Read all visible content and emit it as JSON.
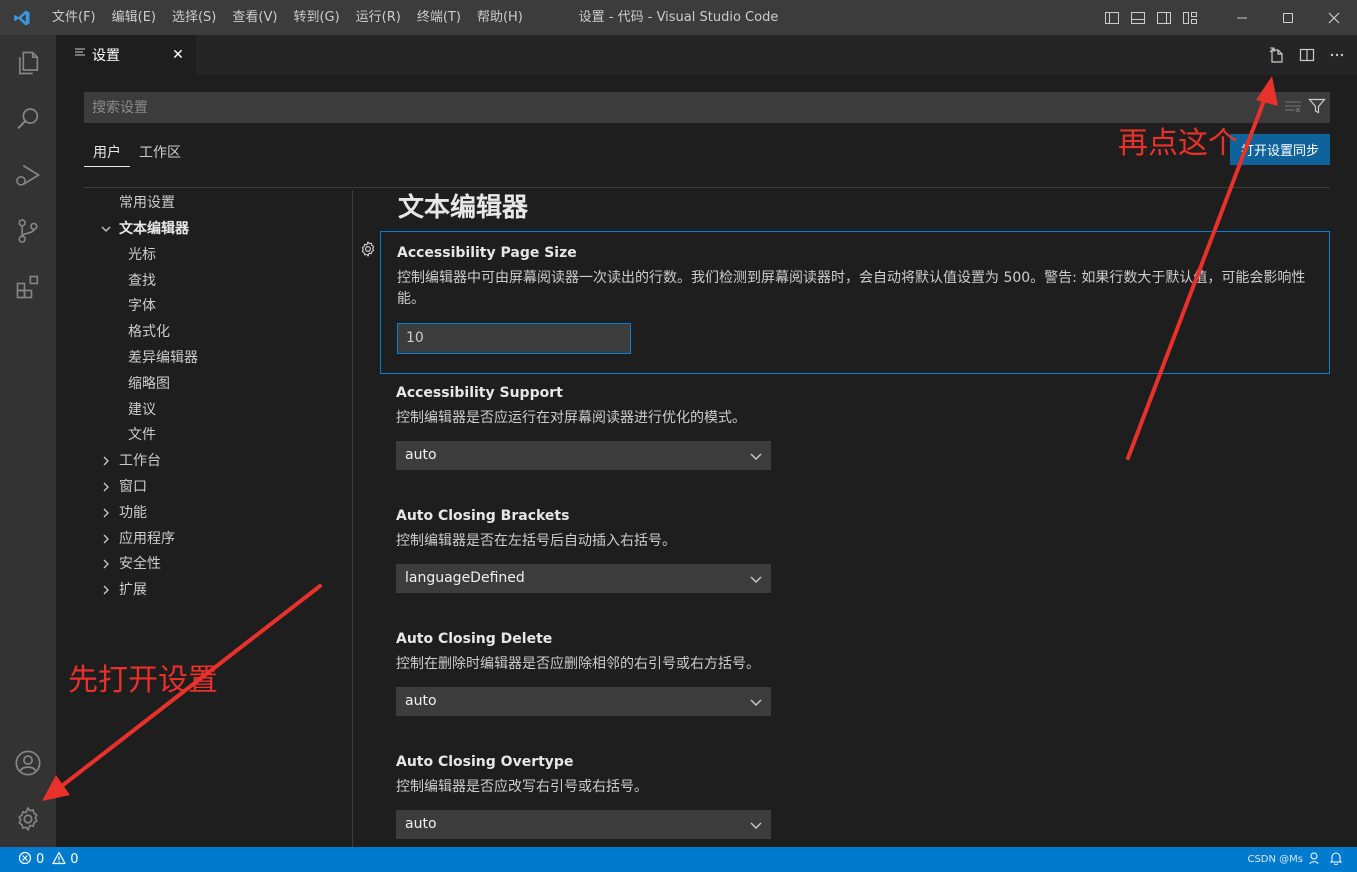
{
  "titlebar": {
    "menu": [
      "文件(F)",
      "编辑(E)",
      "选择(S)",
      "查看(V)",
      "转到(G)",
      "运行(R)",
      "终端(T)",
      "帮助(H)"
    ],
    "title": "设置 - 代码 - Visual Studio Code"
  },
  "tab": {
    "label": "设置",
    "close": "✕"
  },
  "search": {
    "placeholder": "搜索设置"
  },
  "scope": {
    "user": "用户",
    "workspace": "工作区",
    "sync_button": "打开设置同步"
  },
  "toc": {
    "items": [
      {
        "label": "常用设置"
      },
      {
        "label": "文本编辑器",
        "expanded": true
      },
      {
        "label": "光标"
      },
      {
        "label": "查找"
      },
      {
        "label": "字体"
      },
      {
        "label": "格式化"
      },
      {
        "label": "差异编辑器"
      },
      {
        "label": "缩略图"
      },
      {
        "label": "建议"
      },
      {
        "label": "文件"
      },
      {
        "label": "工作台",
        "collapsed": true
      },
      {
        "label": "窗口",
        "collapsed": true
      },
      {
        "label": "功能",
        "collapsed": true
      },
      {
        "label": "应用程序",
        "collapsed": true
      },
      {
        "label": "安全性",
        "collapsed": true
      },
      {
        "label": "扩展",
        "collapsed": true
      }
    ]
  },
  "section": {
    "title": "文本编辑器"
  },
  "settings": [
    {
      "title": "Accessibility Page Size",
      "desc": "控制编辑器中可由屏幕阅读器一次读出的行数。我们检测到屏幕阅读器时，会自动将默认值设置为 500。警告: 如果行数大于默认值，可能会影响性能。",
      "value": "10",
      "control": "text"
    },
    {
      "title": "Accessibility Support",
      "desc": "控制编辑器是否应运行在对屏幕阅读器进行优化的模式。",
      "value": "auto",
      "control": "select"
    },
    {
      "title": "Auto Closing Brackets",
      "desc": "控制编辑器是否在左括号后自动插入右括号。",
      "value": "languageDefined",
      "control": "select"
    },
    {
      "title": "Auto Closing Delete",
      "desc": "控制在删除时编辑器是否应删除相邻的右引号或右方括号。",
      "value": "auto",
      "control": "select"
    },
    {
      "title": "Auto Closing Overtype",
      "desc": "控制编辑器是否应改写右引号或右括号。",
      "value": "auto",
      "control": "select"
    }
  ],
  "statusbar": {
    "errors": "0",
    "warnings": "0",
    "watermark": "CSDN @Ms"
  },
  "annotations": {
    "open_settings": "先打开设置",
    "click_this": "再点这个"
  },
  "colors": {
    "accent": "#007acc",
    "button": "#0e639c",
    "annotation": "#e8312a"
  }
}
